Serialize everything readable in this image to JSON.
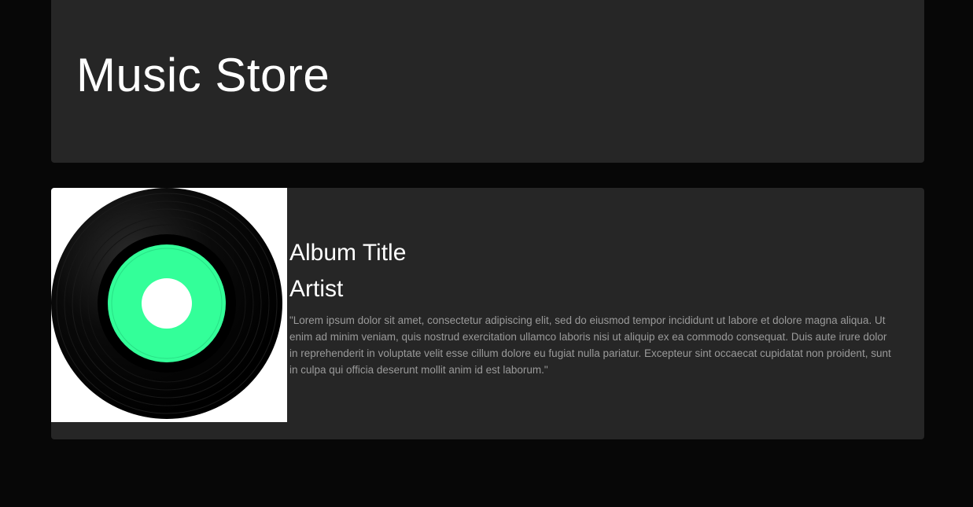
{
  "header": {
    "title": "Music Store"
  },
  "album": {
    "title": "Album Title",
    "artist": "Artist",
    "description": "\"Lorem ipsum dolor sit amet, consectetur adipiscing elit, sed do eiusmod tempor incididunt ut labore et dolore magna aliqua. Ut enim ad minim veniam, quis nostrud exercitation ullamco laboris nisi ut aliquip ex ea commodo consequat. Duis aute irure dolor in reprehenderit in voluptate velit esse cillum dolore eu fugiat nulla pariatur. Excepteur sint occaecat cupidatat non proident, sunt in culpa qui officia deserunt mollit anim id est laborum.\"",
    "art_icon": "vinyl-record-icon",
    "label_color": "#33ff99"
  },
  "colors": {
    "page_background": "#070707",
    "card_background": "#262626",
    "text_primary": "#ffffff",
    "text_secondary": "#9a9a9a"
  }
}
